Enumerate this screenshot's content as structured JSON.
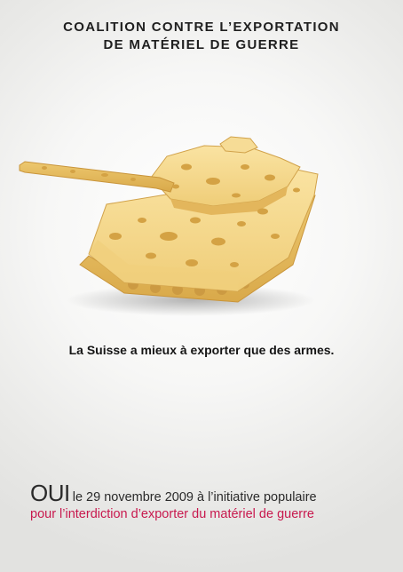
{
  "header": {
    "line1": "COALITION CONTRE L’EXPORTATION",
    "line2": "DE MATÉRIEL DE GUERRE"
  },
  "illustration": {
    "icon": "cheese-tank-icon",
    "colors": {
      "cheese": "#f2d27f",
      "cheese_shadow": "#d9a94a",
      "holes": "#d4a244"
    }
  },
  "tagline": "La Suisse a mieux à exporter que des armes.",
  "footer": {
    "oui": "OUI",
    "line1_rest": "le 29 novembre 2009 à l’initiative populaire",
    "line2": "pour l’interdiction d’exporter du matériel de guerre"
  },
  "colors": {
    "accent": "#c8194e",
    "text": "#1f1f1f"
  }
}
